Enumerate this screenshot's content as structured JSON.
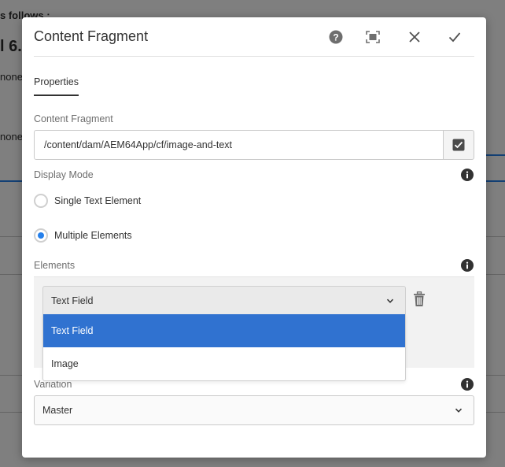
{
  "background": {
    "fragment_1": "s follows :",
    "fragment_2": "l 6.",
    "fragment_3": "none",
    "fragment_4": "none"
  },
  "dialog": {
    "title": "Content Fragment",
    "header_icons": [
      "help-icon",
      "fullscreen-icon",
      "close-icon",
      "checkmark-icon"
    ]
  },
  "tabs": [
    {
      "label": "Properties",
      "active": true
    }
  ],
  "content_fragment": {
    "label": "Content Fragment",
    "value": "/content/dam/AEM64App/cf/image-and-text",
    "picker_icon": "checkbox-picker-icon"
  },
  "display_mode": {
    "label": "Display Mode",
    "options": [
      {
        "label": "Single Text Element",
        "checked": false
      },
      {
        "label": "Multiple Elements",
        "checked": true
      }
    ]
  },
  "elements": {
    "label": "Elements",
    "selected": "Text Field",
    "options": [
      {
        "label": "Text Field",
        "selected": true
      },
      {
        "label": "Image",
        "selected": false
      }
    ]
  },
  "variation": {
    "label": "Variation",
    "selected": "Master"
  },
  "colors": {
    "accent": "#2680eb",
    "selected_option": "#3072d0",
    "overlay": "rgba(0,0,0,0.5)"
  }
}
